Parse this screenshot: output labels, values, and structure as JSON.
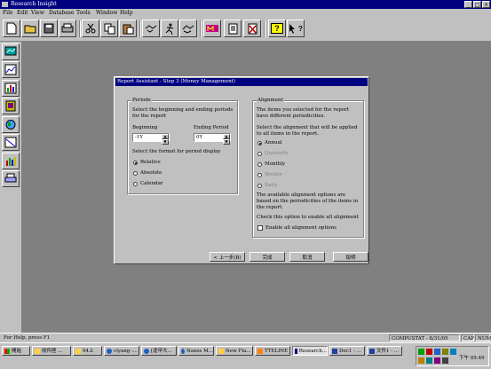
{
  "window": {
    "title": "Research Insight",
    "min_glyph": "_",
    "max_glyph": "□",
    "close_glyph": "×"
  },
  "menubar": [
    "File",
    "Edit",
    "View",
    "Database",
    "Tools",
    "Window",
    "Help"
  ],
  "toolbar": {
    "icons": [
      "new-file",
      "open-folder",
      "save-disk",
      "print",
      "cut",
      "copy",
      "paste",
      "handshake",
      "run",
      "report-m",
      "catalog",
      "delete-x",
      "help-question",
      "context-help"
    ],
    "help_glyph": "?",
    "context_help_glyph": "?"
  },
  "leftbar": {
    "icons": [
      "screen-tool",
      "chart-tool",
      "bar-chart-tool",
      "book-tool",
      "globe-tool",
      "calendar-tool",
      "stats-tool",
      "print-tool"
    ]
  },
  "dialog": {
    "title": "Report Assistant - Step 3  (Money Management)",
    "periods": {
      "legend": "Periods",
      "intro": "Select the beginning and ending periods for the report",
      "beginning_label": "Beginning",
      "beginning_value": "-1Y",
      "ending_label": "Ending Period",
      "ending_value": "0Y",
      "format_prompt": "Select the format for period display",
      "formats": [
        {
          "label": "Relative",
          "selected": true
        },
        {
          "label": "Absolute",
          "selected": false
        },
        {
          "label": "Calendar",
          "selected": false
        }
      ]
    },
    "alignment": {
      "legend": "Alignment",
      "intro": "The items you selected for the report have different periodicities.",
      "prompt": "Select the alignment that will be applied to all items in the report.",
      "options": [
        {
          "label": "Annual",
          "selected": true,
          "enabled": true
        },
        {
          "label": "Quarterly",
          "selected": false,
          "enabled": false
        },
        {
          "label": "Monthly",
          "selected": false,
          "enabled": true
        },
        {
          "label": "Weekly",
          "selected": false,
          "enabled": false
        },
        {
          "label": "Daily",
          "selected": false,
          "enabled": false
        }
      ],
      "note": "The available alignment options are based on the periodicities of the items in the report.",
      "check_prompt": "Check this option to enable all alignment",
      "enable_all_label": "Enable all alignment options",
      "enable_all_checked": false
    },
    "buttons": {
      "back": "< 上一步(B)",
      "finish": "完成",
      "cancel": "取消",
      "help": "說明"
    }
  },
  "statusbar": {
    "help_text": "For Help, press F1",
    "database": "COMPUSTAT - 8/31/05",
    "caps": "CAP",
    "num": "NUM"
  },
  "taskbar": {
    "start_label": "開始",
    "tasks": [
      "收件匣 ...",
      "94上",
      "clyang -...",
      "[逢甲大...",
      "Naxos M...",
      "New Fla...",
      "TTELINE",
      "Research...",
      "Doc1 - ...",
      "文件1 - ..."
    ],
    "active_task": 7,
    "clock": "下午 05:49"
  },
  "colors": {
    "titlebar": "#000080",
    "face": "#c0c0c0",
    "desktop": "#808080"
  }
}
